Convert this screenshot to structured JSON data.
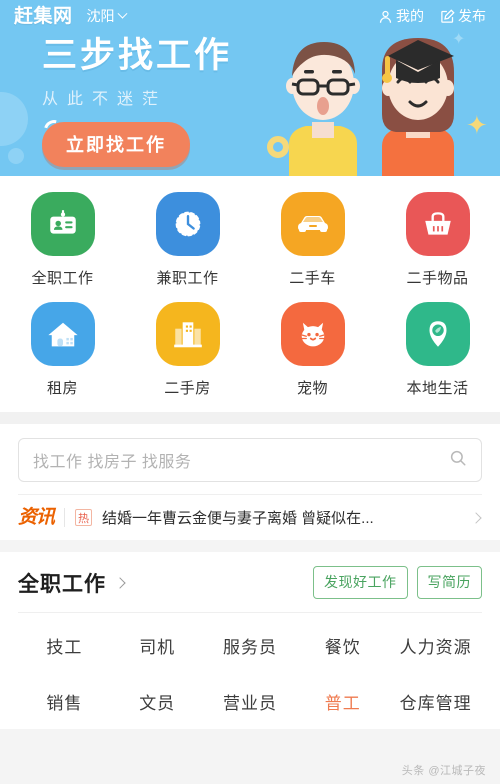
{
  "header": {
    "logo": "赶集网",
    "city": "沈阳",
    "city_chevron_icon": "chevron-down-icon",
    "actions": [
      {
        "icon": "person-icon",
        "label": "我的"
      },
      {
        "icon": "edit-square-icon",
        "label": "发布"
      }
    ]
  },
  "banner": {
    "title": "三步找工作",
    "subtitle": "从此不迷茫",
    "cta_label": "立即找工作",
    "bg_color": "#74c7f2",
    "cta_color": "#f2825c",
    "illustration": "two-job-seekers-illustration"
  },
  "categories": [
    {
      "label": "全职工作",
      "icon": "id-badge-icon",
      "color": "#3aab5e"
    },
    {
      "label": "兼职工作",
      "icon": "clock-icon",
      "color": "#3d8fdd"
    },
    {
      "label": "二手车",
      "icon": "car-icon",
      "color": "#f5a623"
    },
    {
      "label": "二手物品",
      "icon": "basket-icon",
      "color": "#e95757"
    },
    {
      "label": "租房",
      "icon": "house-icon",
      "color": "#46a6e8"
    },
    {
      "label": "二手房",
      "icon": "building-icon",
      "color": "#f5b61e"
    },
    {
      "label": "宠物",
      "icon": "cat-icon",
      "color": "#f4693f"
    },
    {
      "label": "本地生活",
      "icon": "location-pin-icon",
      "color": "#2fb88a"
    }
  ],
  "search": {
    "placeholder": "找工作 找房子 找服务",
    "value": "",
    "icon": "search-icon"
  },
  "news": {
    "logo": "资讯",
    "badge": "热",
    "headline": "结婚一年曹云金便与妻子离婚 曾疑似在...",
    "chevron_icon": "chevron-right-icon"
  },
  "job_section": {
    "title": "全职工作",
    "chevron_icon": "chevron-right-icon",
    "pills": [
      {
        "label": "发现好工作"
      },
      {
        "label": "写简历"
      }
    ],
    "pill_color": "#49a35f",
    "rows": [
      [
        {
          "label": "技工",
          "highlight": false
        },
        {
          "label": "司机",
          "highlight": false
        },
        {
          "label": "服务员",
          "highlight": false
        },
        {
          "label": "餐饮",
          "highlight": false
        },
        {
          "label": "人力资源",
          "highlight": false
        }
      ],
      [
        {
          "label": "销售",
          "highlight": false
        },
        {
          "label": "文员",
          "highlight": false
        },
        {
          "label": "营业员",
          "highlight": false
        },
        {
          "label": "普工",
          "highlight": true
        },
        {
          "label": "仓库管理",
          "highlight": false
        }
      ]
    ],
    "highlight_color": "#ef7b50"
  },
  "watermark": "头条 @江城子夜"
}
